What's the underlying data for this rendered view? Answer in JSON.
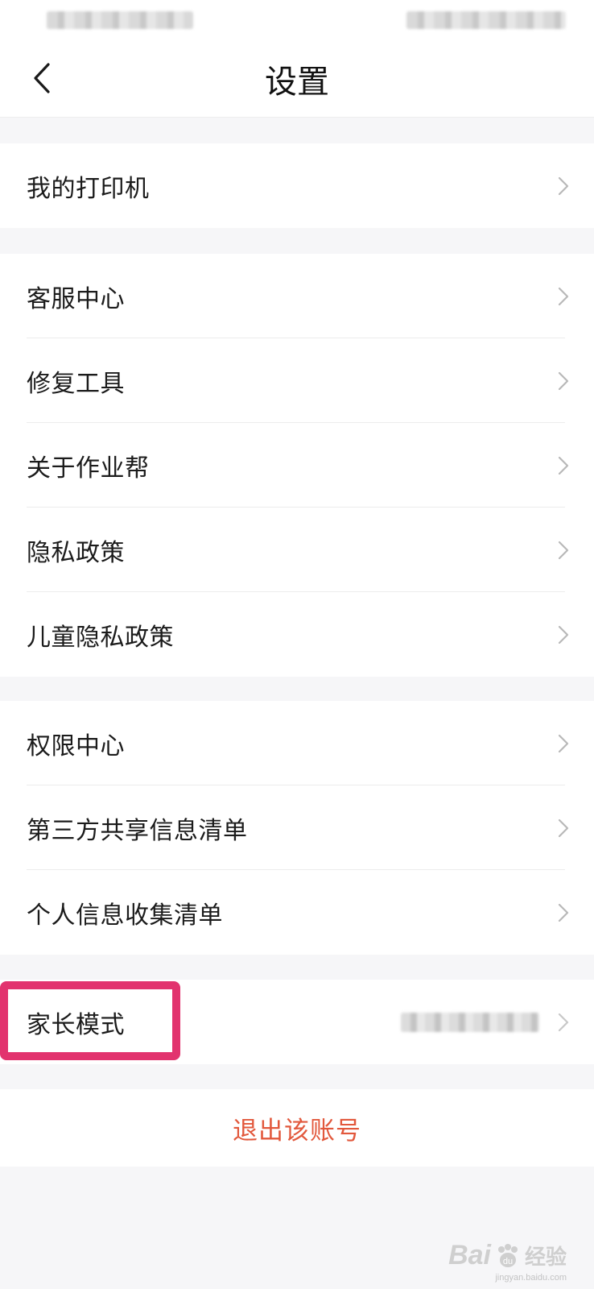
{
  "header": {
    "title": "设置",
    "back_icon": "chevron-left-icon"
  },
  "groups": [
    {
      "items": [
        {
          "label": "我的打印机"
        }
      ]
    },
    {
      "items": [
        {
          "label": "客服中心"
        },
        {
          "label": "修复工具"
        },
        {
          "label": "关于作业帮"
        },
        {
          "label": "隐私政策"
        },
        {
          "label": "儿童隐私政策"
        }
      ]
    },
    {
      "items": [
        {
          "label": "权限中心"
        },
        {
          "label": "第三方共享信息清单"
        },
        {
          "label": "个人信息收集清单"
        }
      ]
    },
    {
      "items": [
        {
          "label": "家长模式"
        }
      ]
    }
  ],
  "logout": {
    "label": "退出该账号",
    "color": "#e2583c"
  },
  "highlight": {
    "color": "#e2336e"
  },
  "watermark": {
    "text": "Bai",
    "paw": "du",
    "cn": "经验",
    "url": "jingyan.baidu.com"
  }
}
